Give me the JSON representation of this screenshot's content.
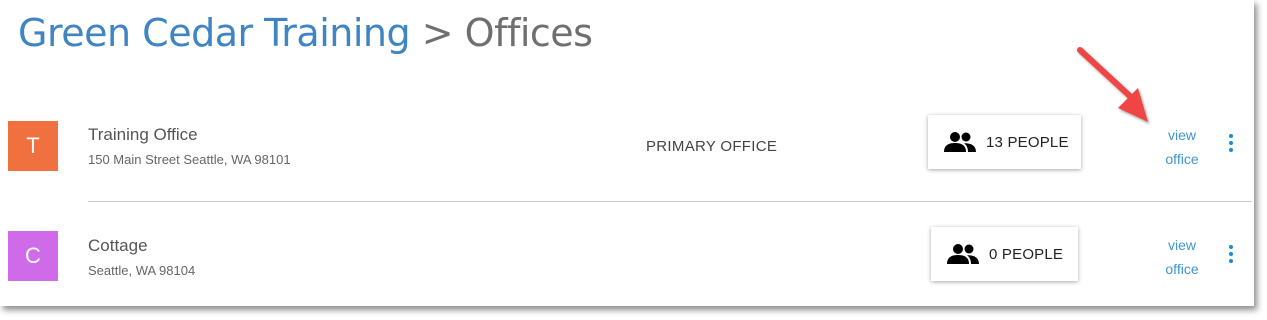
{
  "breadcrumb": {
    "parent": "Green Cedar Training",
    "separator": ">",
    "current": "Offices"
  },
  "offices": [
    {
      "initial": "T",
      "color": "#f07040",
      "name": "Training Office",
      "address": "150 Main Street Seattle, WA 98101",
      "badge": "PRIMARY OFFICE",
      "people": "13 PEOPLE",
      "view_link": [
        "view",
        "office"
      ]
    },
    {
      "initial": "C",
      "color": "#cf6ae9",
      "name": "Cottage",
      "address": "Seattle, WA 98104",
      "badge": "",
      "people": "0 PEOPLE",
      "view_link": [
        "view",
        "office"
      ]
    }
  ],
  "colors": {
    "link": "#3f95d0",
    "breadcrumb_link": "#3f84c3",
    "kebab": "#1a8cd8",
    "annotation_arrow": "#f04545"
  },
  "icons": {
    "people": "people-icon",
    "menu": "more-vertical-icon"
  }
}
